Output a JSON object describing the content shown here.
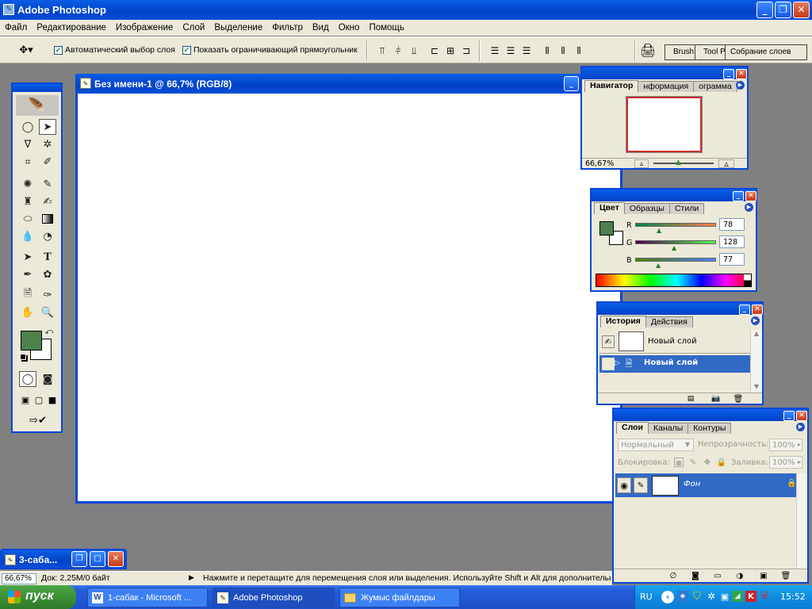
{
  "app": {
    "title": "Adobe Photoshop"
  },
  "menu": [
    "Файл",
    "Редактирование",
    "Изображение",
    "Слой",
    "Выделение",
    "Фильтр",
    "Вид",
    "Окно",
    "Помощь"
  ],
  "options": {
    "auto_select": "Автоматический выбор слоя",
    "show_bounds": "Показать ограничивающий прямоугольник",
    "palette_tabs": [
      "Brush",
      "Tool P",
      "Собрание слоев"
    ]
  },
  "document": {
    "title": "Без имени-1 @ 66,7% (RGB/8)"
  },
  "navigator": {
    "tabs": [
      "Навигатор",
      "нформация",
      "ограмма"
    ],
    "zoom": "66,67%"
  },
  "color": {
    "tabs": [
      "Цвет",
      "Образцы",
      "Стили"
    ],
    "channels": [
      {
        "label": "R",
        "value": "78"
      },
      {
        "label": "G",
        "value": "128"
      },
      {
        "label": "B",
        "value": "77"
      }
    ],
    "foreground": "#4e804d"
  },
  "history": {
    "tabs": [
      "История",
      "Действия"
    ],
    "snapshot": "Новый слой",
    "state": "Новый слой"
  },
  "layers": {
    "tabs": [
      "Слои",
      "Каналы",
      "Контуры"
    ],
    "blend_mode": "Нормальный",
    "opacity_label": "Непрозрачность:",
    "opacity": "100%",
    "lock_label": "Блокировка:",
    "fill_label": "Заливка:",
    "fill": "100%",
    "layer_name": "Фон"
  },
  "minimized_doc": {
    "title": "3-саба..."
  },
  "status": {
    "zoom": "66,67%",
    "doc": "Док: 2,25M/0 байт",
    "hint": "Нажмите и перетащите для перемещения слоя или выделения. Используйте Shift и Alt для дополнительн"
  },
  "taskbar": {
    "start": "пуск",
    "tasks": [
      "1-сабак - Microsoft ...",
      "Adobe Photoshop",
      "Жумыс файлдары"
    ],
    "lang": "RU",
    "clock": "15:52"
  }
}
